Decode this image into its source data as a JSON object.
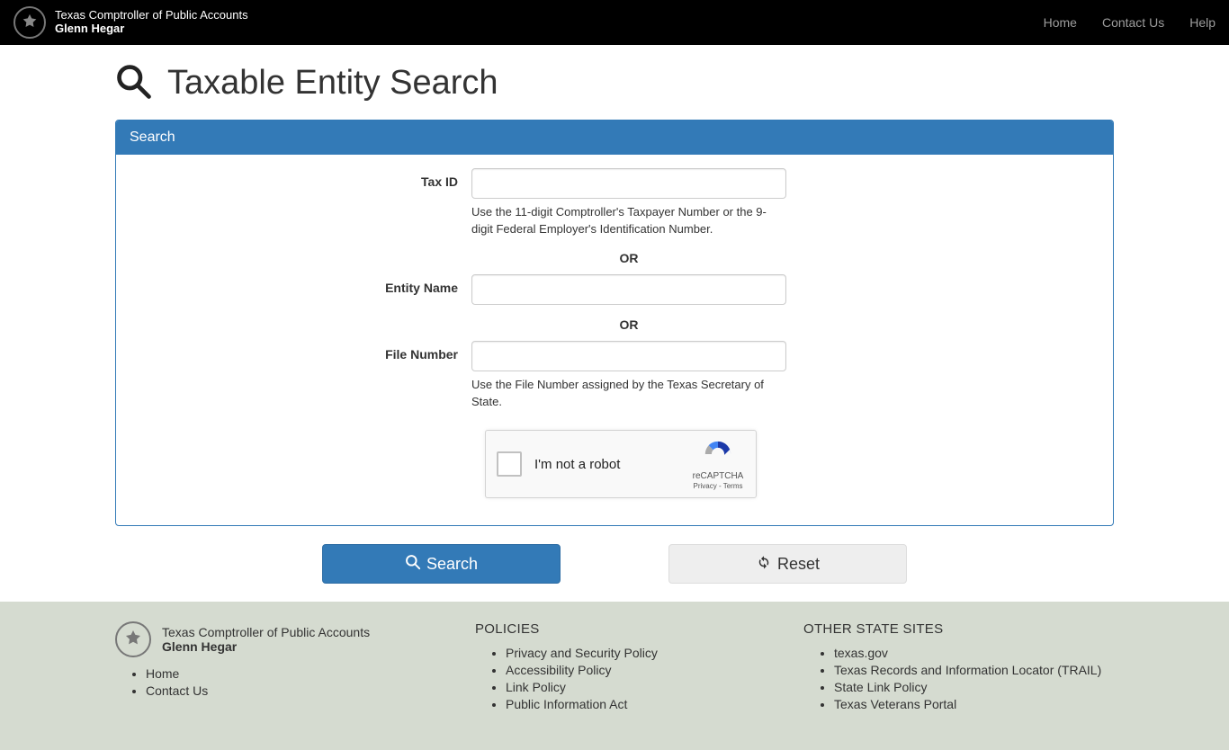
{
  "header": {
    "org": "Texas Comptroller of Public Accounts",
    "name": "Glenn Hegar",
    "nav": {
      "home": "Home",
      "contact": "Contact Us",
      "help": "Help"
    }
  },
  "page": {
    "title": "Taxable Entity Search"
  },
  "panel": {
    "heading": "Search",
    "or": "OR",
    "tax_id": {
      "label": "Tax ID",
      "value": "",
      "help": "Use the 11-digit Comptroller's Taxpayer Number or the 9-digit Federal Employer's Identification Number."
    },
    "entity_name": {
      "label": "Entity Name",
      "value": ""
    },
    "file_number": {
      "label": "File Number",
      "value": "",
      "help": "Use the File Number assigned by the Texas Secretary of State."
    },
    "recaptcha": {
      "label": "I'm not a robot",
      "brand": "reCAPTCHA",
      "terms": "Privacy - Terms"
    }
  },
  "buttons": {
    "search": "Search",
    "reset": "Reset"
  },
  "footer": {
    "org": "Texas Comptroller of Public Accounts",
    "name": "Glenn Hegar",
    "left_links": [
      "Home",
      "Contact Us"
    ],
    "policies_title": "POLICIES",
    "policies": [
      "Privacy and Security Policy",
      "Accessibility Policy",
      "Link Policy",
      "Public Information Act"
    ],
    "other_title": "OTHER STATE SITES",
    "other": [
      "texas.gov",
      "Texas Records and Information Locator (TRAIL)",
      "State Link Policy",
      "Texas Veterans Portal"
    ]
  }
}
